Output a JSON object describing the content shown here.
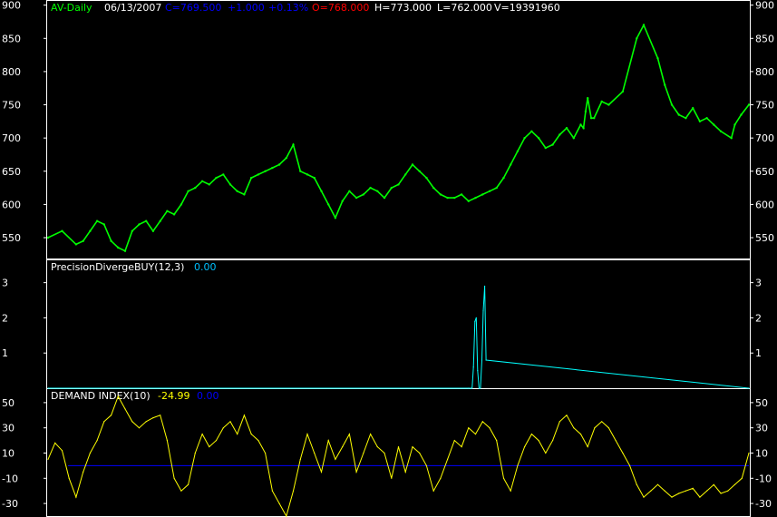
{
  "colors": {
    "background": "#000000",
    "border": "#ffffff",
    "price": "#00ff00",
    "pdb": "#00ffff",
    "demand": "#ffff00",
    "zero_line": "#0000ff",
    "header_symbol": "#00ff00",
    "header_white": "#ffffff",
    "header_blue": "#0000ff",
    "header_red": "#ff0000",
    "header_cyan": "#00c0ff"
  },
  "header": {
    "symbol": "AV-Daily",
    "date": "06/13/2007",
    "close": "C=769.500",
    "change": "+1.000",
    "change_pct": "+0.13%",
    "open": "O=768.000",
    "high": "H=773.000",
    "low": "L=762.000",
    "volume": "V=19391960"
  },
  "indicator_labels": {
    "pdb_name": "PrecisionDivergeBUY(12,3)",
    "pdb_value": "0.00",
    "demand_name": "DEMAND INDEX(10)",
    "demand_value": "-24.99",
    "demand_signal": "0.00"
  },
  "chart_data": [
    {
      "type": "line",
      "name": "price",
      "ylim": [
        520,
        905
      ],
      "yticks": [
        "900",
        "850",
        "800",
        "750",
        "700",
        "650",
        "600",
        "550"
      ],
      "grid": false,
      "x": [
        0,
        20,
        40,
        50,
        60,
        70,
        80,
        90,
        100,
        110,
        120,
        130,
        140,
        150,
        160,
        170,
        180,
        190,
        200,
        210,
        220,
        230,
        240,
        250,
        260,
        270,
        280,
        290,
        300,
        310,
        320,
        330,
        340,
        350,
        360,
        370,
        380,
        390,
        400,
        410,
        420,
        430,
        440,
        450,
        460,
        470,
        480,
        490,
        500,
        510,
        520,
        530,
        540,
        550,
        560,
        570,
        580,
        590,
        600,
        610,
        620,
        630,
        640,
        650,
        660,
        670,
        680,
        690,
        700,
        710,
        720,
        730,
        740,
        750,
        760,
        764,
        767,
        770,
        775,
        779,
        790,
        800,
        820,
        840,
        850,
        870,
        880,
        890,
        900,
        910,
        920,
        930,
        940,
        950,
        960,
        975,
        980,
        989,
        1000
      ],
      "values": [
        550,
        560,
        540,
        545,
        560,
        575,
        570,
        545,
        535,
        530,
        560,
        570,
        575,
        560,
        575,
        590,
        585,
        600,
        620,
        625,
        635,
        630,
        640,
        645,
        630,
        620,
        615,
        640,
        645,
        650,
        655,
        660,
        670,
        690,
        650,
        645,
        640,
        620,
        600,
        580,
        605,
        620,
        610,
        615,
        625,
        620,
        610,
        625,
        630,
        645,
        660,
        650,
        640,
        625,
        615,
        610,
        610,
        615,
        605,
        610,
        615,
        620,
        625,
        640,
        660,
        680,
        700,
        710,
        700,
        685,
        690,
        705,
        715,
        700,
        720,
        715,
        740,
        760,
        730,
        730,
        755,
        750,
        770,
        850,
        870,
        820,
        780,
        750,
        735,
        730,
        745,
        725,
        730,
        720,
        710,
        700,
        720,
        735,
        750
      ]
    },
    {
      "type": "line",
      "name": "PrecisionDivergeBUY(12,3)",
      "ylim": [
        0,
        3.3
      ],
      "yticks": [
        "3",
        "2",
        "1"
      ],
      "x": [
        0,
        520,
        600,
        605,
        607,
        609,
        611,
        613,
        615,
        617,
        619,
        621,
        623,
        625,
        1000
      ],
      "values": [
        0,
        0,
        0,
        0,
        0.6,
        1.9,
        2.0,
        0.5,
        0,
        0,
        0.8,
        2.2,
        2.9,
        0.8,
        0
      ]
    },
    {
      "type": "line",
      "name": "DEMAND INDEX(10)",
      "ylim": [
        -40,
        60
      ],
      "yticks": [
        "50",
        "30",
        "10",
        "-10",
        "-30"
      ],
      "zero_line": 0,
      "x": [
        0,
        10,
        20,
        30,
        40,
        50,
        60,
        70,
        80,
        90,
        100,
        110,
        120,
        130,
        140,
        150,
        160,
        170,
        180,
        190,
        200,
        210,
        220,
        230,
        240,
        250,
        260,
        270,
        280,
        290,
        300,
        310,
        320,
        330,
        340,
        350,
        360,
        370,
        380,
        390,
        400,
        410,
        420,
        430,
        440,
        450,
        460,
        470,
        480,
        490,
        500,
        510,
        520,
        530,
        540,
        550,
        560,
        570,
        580,
        590,
        600,
        610,
        620,
        630,
        640,
        650,
        660,
        670,
        680,
        690,
        700,
        710,
        720,
        730,
        740,
        750,
        760,
        770,
        780,
        790,
        800,
        810,
        820,
        830,
        840,
        850,
        860,
        870,
        880,
        890,
        900,
        910,
        920,
        930,
        940,
        950,
        960,
        970,
        980,
        990,
        1000
      ],
      "values": [
        5,
        18,
        12,
        -10,
        -25,
        -5,
        10,
        20,
        35,
        40,
        55,
        45,
        35,
        30,
        35,
        38,
        40,
        20,
        -10,
        -20,
        -15,
        10,
        25,
        15,
        20,
        30,
        35,
        25,
        40,
        25,
        20,
        10,
        -20,
        -30,
        -40,
        -20,
        5,
        25,
        10,
        -5,
        20,
        5,
        15,
        25,
        -5,
        10,
        25,
        15,
        10,
        -10,
        15,
        -5,
        15,
        10,
        0,
        -20,
        -10,
        5,
        20,
        15,
        30,
        25,
        35,
        30,
        20,
        -10,
        -20,
        0,
        15,
        25,
        20,
        10,
        20,
        35,
        40,
        30,
        25,
        15,
        30,
        35,
        30,
        20,
        10,
        0,
        -15,
        -25,
        -20,
        -15,
        -20,
        -25,
        -22,
        -20,
        -18,
        -25,
        -20,
        -15,
        -22,
        -20,
        -15,
        -10,
        10
      ]
    }
  ]
}
